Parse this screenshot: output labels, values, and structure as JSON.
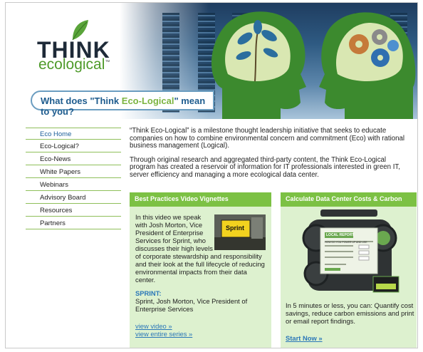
{
  "logo": {
    "line1": "THINK",
    "line2": "ecological",
    "tm": "™"
  },
  "tagline": {
    "before": "What does \"Think ",
    "highlight": "Eco-Logical",
    "after": "\" mean to you?"
  },
  "nav": [
    {
      "label": "Eco Home"
    },
    {
      "label": "Eco-Logical?"
    },
    {
      "label": "Eco-News"
    },
    {
      "label": "White Papers"
    },
    {
      "label": "Webinars"
    },
    {
      "label": "Advisory Board"
    },
    {
      "label": "Resources"
    },
    {
      "label": "Partners"
    }
  ],
  "intro": {
    "p1": "“Think Eco-Logical” is a milestone thought leadership initiative that seeks to educate companies on how to combine environmental concern and commitment (Eco) with rational business management (Logical).",
    "p2": "Through original research and aggregated third-party content, the Think Eco-Logical program has created a reservoir of information for IT professionals interested in green IT, server efficiency and managing a more ecological data center."
  },
  "video_box": {
    "heading": "Best Practices Video Vignettes",
    "description": "In this video we speak with Josh Morton, Vice President of Enterprise Services for Sprint, who discusses their high levels of corporate stewardship and responsibility and their look at the full lifecycle of reducing environmental impacts from their data center.",
    "thumbnail_text": "Sprint",
    "company": "SPRINT:",
    "person": "Sprint, Josh Morton, Vice President of Enterprise Services",
    "view_video": "view video »",
    "view_series": "view entire series »"
  },
  "calc_box": {
    "heading": "Calculate Data Center Costs & Carbon",
    "device_title": "LOCAL REPORT",
    "device_subtitle": "HOW DO YOU POWER UP AND USE",
    "description": "In 5 minutes or less, you can: Quantify cost savings, reduce carbon emissions and print or email report findings.",
    "cta": "Start Now »"
  },
  "colors": {
    "accent_green": "#7cc144",
    "box_bg": "#ddf1cf",
    "link_blue": "#2a77b8",
    "nav_border": "#8fbf5a"
  }
}
